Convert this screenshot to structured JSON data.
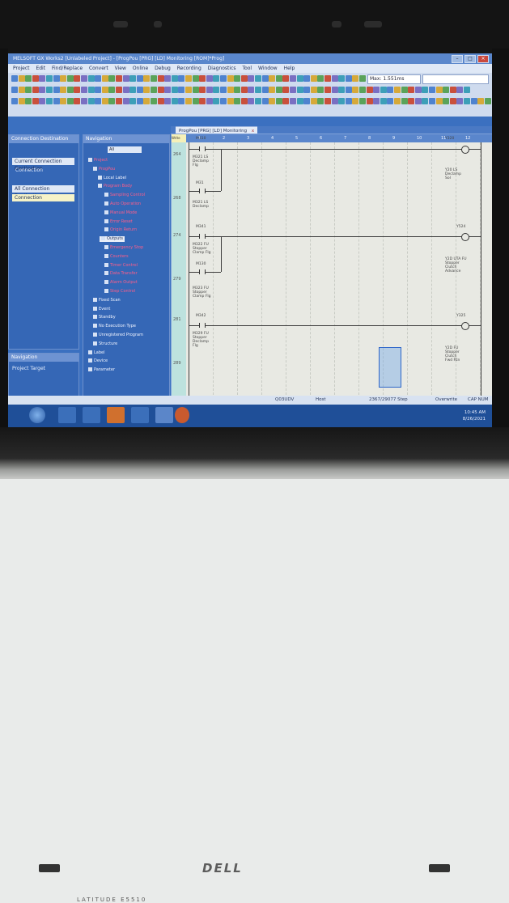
{
  "window": {
    "title": "MELSOFT GX Works2 [Unlabeled Project] - [ProgPou [PRG] [LD] Monitoring [ROM]*Prog]"
  },
  "menu": [
    "Project",
    "Edit",
    "Find/Replace",
    "Convert",
    "View",
    "Online",
    "Debug",
    "Recording",
    "Diagnostics",
    "Tool",
    "Window",
    "Help"
  ],
  "toolbar": {
    "zoom_value": "Max: 1.551ms"
  },
  "connection_panel": {
    "title": "Connection Destination",
    "current_header": "Current Connection Destination",
    "current_item": "Connection",
    "all_header": "All Connection Destination",
    "all_item": "Connection"
  },
  "navigation_panel": {
    "title": "Navigation",
    "filter": "All",
    "items": [
      {
        "label": "Project",
        "red": true
      },
      {
        "label": "ProgPou",
        "red": true
      },
      {
        "label": "Local Label",
        "red": false
      },
      {
        "label": "Program Body",
        "red": true
      },
      {
        "label": "Sampling Control",
        "red": true
      },
      {
        "label": "Auto Operation",
        "red": true
      },
      {
        "label": "Manual Mode",
        "red": true
      },
      {
        "label": "Error Reset",
        "red": true
      },
      {
        "label": "Origin Return",
        "red": true
      },
      {
        "label": "Outputs",
        "red": false,
        "selected": true
      },
      {
        "label": "Emergency Stop",
        "red": true
      },
      {
        "label": "Counters",
        "red": true
      },
      {
        "label": "Timer Control",
        "red": true
      },
      {
        "label": "Data Transfer",
        "red": true
      },
      {
        "label": "Alarm Output",
        "red": true
      },
      {
        "label": "Step Control",
        "red": true
      },
      {
        "label": "Fixed Scan",
        "red": false
      },
      {
        "label": "Event",
        "red": false
      },
      {
        "label": "Standby",
        "red": false
      },
      {
        "label": "No Execution Type",
        "red": false
      },
      {
        "label": "Unregistered Program",
        "red": false
      },
      {
        "label": "Structure",
        "red": false
      },
      {
        "label": "Label",
        "red": false
      },
      {
        "label": "Device",
        "red": false
      },
      {
        "label": "Parameter",
        "red": false
      }
    ],
    "bottom_title": "Navigation",
    "bottom_item": "Project Target"
  },
  "editor": {
    "tab_label": "ProgPou [PRG] [LD] Monitoring",
    "tab_close": "x",
    "write_mode": "Write Mode",
    "columns": [
      "1",
      "2",
      "3",
      "4",
      "5",
      "6",
      "7",
      "8",
      "9",
      "10",
      "11",
      "12"
    ],
    "steps": [
      "264",
      "268",
      "274",
      "279",
      "281",
      "289"
    ],
    "labels": {
      "r1_c1": "M310",
      "r1_c1b": "M321 LS\nDeclamp\nFlg",
      "r1_coil": "Y320",
      "r1_coil_desc": "Y20 LS\nDeclamp\nSol",
      "r1_c2": "M31",
      "r1_c2b": "M321 LS\nDeclamp",
      "r2_c1": "M341",
      "r2_c1b": "M322 FU\nStopper\nClamp Flg",
      "r2_c2": "M130",
      "r2_coil": "Y524",
      "r2_coil_desc": "Y2D UTA FU\nStopper\nClutch\nAdvance",
      "r3_c1": "M323 FU\nStopper\nClamp Flg",
      "r3_c2": "M342",
      "r3_c2b": "M329 FU\nStopper\nDeclamp\nFlg",
      "r3_coil": "Y325",
      "r3_coil_desc": "Y2D FU\nStopper\nClutch\nFwd Rtn"
    }
  },
  "statusbar": {
    "a": "Q03UDV",
    "b": "Host",
    "c": "2367/29077 Step",
    "d": "Overwrite",
    "e": "CAP NUM"
  },
  "taskbar": {
    "time": "10:45 AM",
    "date": "8/26/2021"
  },
  "device": {
    "brand": "DELL",
    "model_label": "LATITUDE E5510"
  }
}
